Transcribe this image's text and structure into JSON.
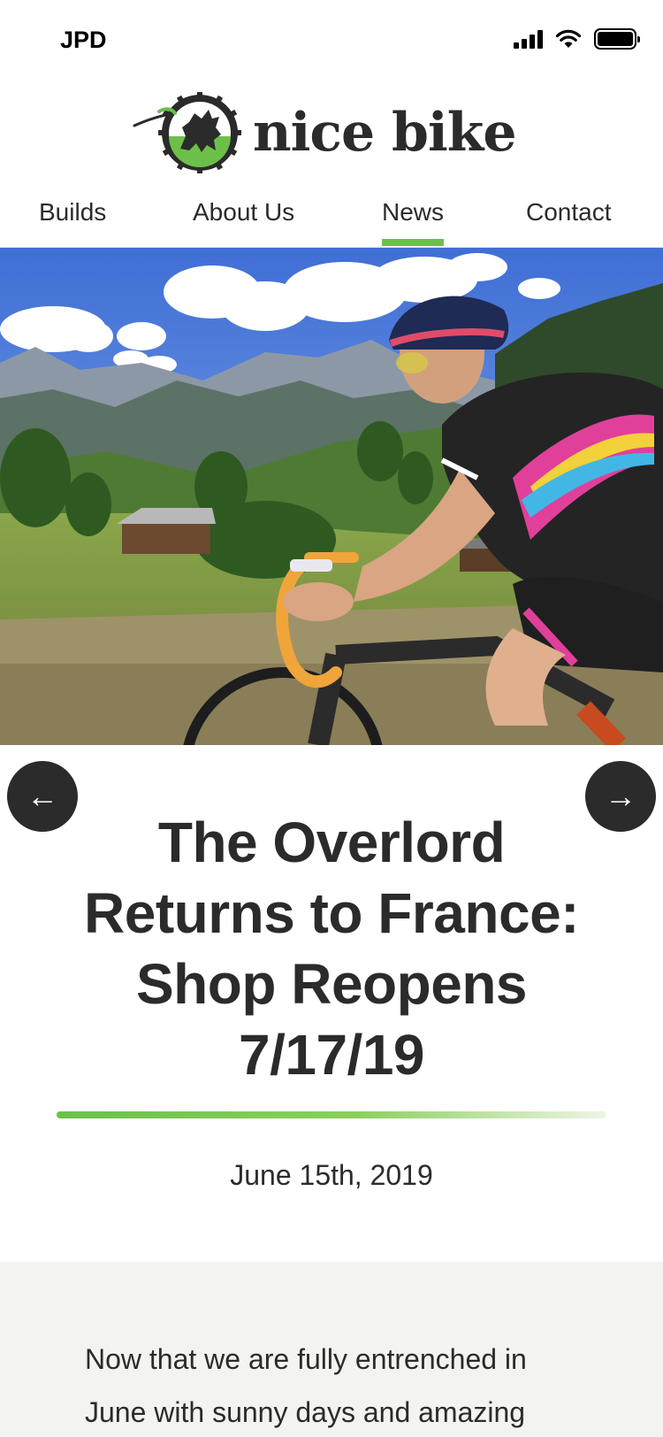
{
  "status_bar": {
    "carrier": "JPD",
    "icons": [
      "signal-icon",
      "wifi-icon",
      "battery-icon"
    ]
  },
  "brand": {
    "name": "nice bike",
    "logo_icon": "dragon-gear-logo",
    "accent_color": "#6cc04a",
    "text_color": "#2b2b2b"
  },
  "nav": {
    "items": [
      {
        "label": "Builds"
      },
      {
        "label": "About Us"
      },
      {
        "label": "News",
        "active": true
      },
      {
        "label": "Contact"
      }
    ]
  },
  "carousel": {
    "prev_icon": "arrow-left-icon",
    "next_icon": "arrow-right-icon",
    "prev_glyph": "←",
    "next_glyph": "→"
  },
  "post": {
    "title": "The Overlord Returns to France: Shop Reopens 7/17/19",
    "date": "June 15th, 2019",
    "body": "Now that we are fully entrenched in June with sunny days and amazing"
  }
}
